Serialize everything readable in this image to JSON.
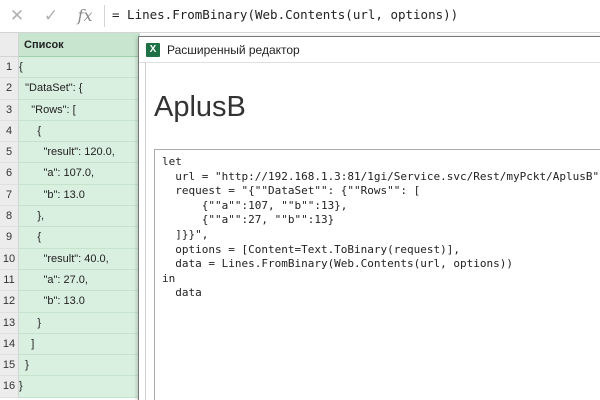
{
  "formula_bar": {
    "cancel_icon": "✕",
    "confirm_icon": "✓",
    "fx_icon": "fx",
    "formula": "= Lines.FromBinary(Web.Contents(url, options))"
  },
  "sheet": {
    "column_header": "Список",
    "rows": [
      {
        "num": "1",
        "value": "{"
      },
      {
        "num": "2",
        "value": "  \"DataSet\": {"
      },
      {
        "num": "3",
        "value": "    \"Rows\": ["
      },
      {
        "num": "4",
        "value": "      {"
      },
      {
        "num": "5",
        "value": "        \"result\": 120.0,"
      },
      {
        "num": "6",
        "value": "        \"a\": 107.0,"
      },
      {
        "num": "7",
        "value": "        \"b\": 13.0"
      },
      {
        "num": "8",
        "value": "      },"
      },
      {
        "num": "9",
        "value": "      {"
      },
      {
        "num": "10",
        "value": "        \"result\": 40.0,"
      },
      {
        "num": "11",
        "value": "        \"a\": 27.0,"
      },
      {
        "num": "12",
        "value": "        \"b\": 13.0"
      },
      {
        "num": "13",
        "value": "      }"
      },
      {
        "num": "14",
        "value": "    ]"
      },
      {
        "num": "15",
        "value": "  }"
      },
      {
        "num": "16",
        "value": "}"
      }
    ]
  },
  "editor": {
    "window_title": "Расширенный редактор",
    "app_icon": "X",
    "query_name": "AplusB",
    "code_lines": [
      "let",
      "  url = \"http://192.168.1.3:81/1gi/Service.svc/Rest/myPckt/AplusB\",",
      "  request = \"{\"\"DataSet\"\": {\"\"Rows\"\": [",
      "      {\"\"a\"\":107, \"\"b\"\":13},",
      "      {\"\"a\"\":27, \"\"b\"\":13}",
      "  ]}}\",",
      "  options = [Content=Text.ToBinary(request)],",
      "  data = Lines.FromBinary(Web.Contents(url, options))",
      "in",
      "  data"
    ]
  }
}
